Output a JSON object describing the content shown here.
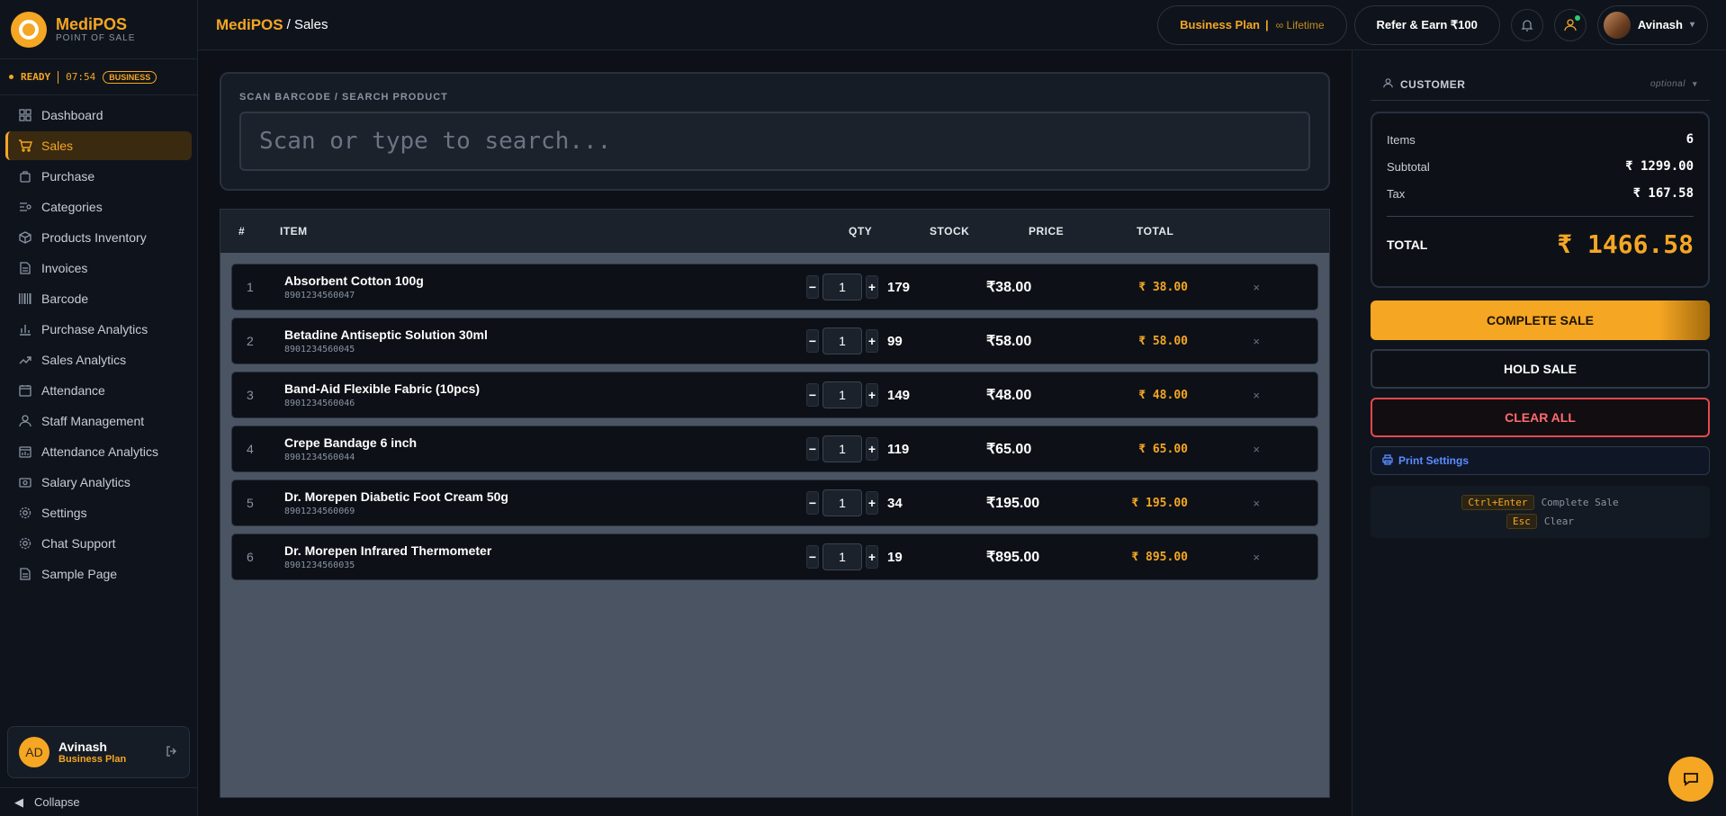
{
  "brand": {
    "name": "MediPOS",
    "subtitle": "POINT OF SALE"
  },
  "status": {
    "state": "READY",
    "time": "07:54",
    "badge": "BUSINESS"
  },
  "sidebar": {
    "items": [
      {
        "label": "Dashboard",
        "icon": "grid-icon",
        "active": false
      },
      {
        "label": "Sales",
        "icon": "cart-icon",
        "active": true
      },
      {
        "label": "Purchase",
        "icon": "bag-icon",
        "active": false
      },
      {
        "label": "Categories",
        "icon": "list-filter-icon",
        "active": false
      },
      {
        "label": "Products Inventory",
        "icon": "box-icon",
        "active": false
      },
      {
        "label": "Invoices",
        "icon": "document-icon",
        "active": false
      },
      {
        "label": "Barcode",
        "icon": "barcode-icon",
        "active": false
      },
      {
        "label": "Purchase Analytics",
        "icon": "bar-chart-icon",
        "active": false
      },
      {
        "label": "Sales Analytics",
        "icon": "trend-icon",
        "active": false
      },
      {
        "label": "Attendance",
        "icon": "calendar-icon",
        "active": false
      },
      {
        "label": "Staff Management",
        "icon": "user-icon",
        "active": false
      },
      {
        "label": "Attendance Analytics",
        "icon": "calendar-chart-icon",
        "active": false
      },
      {
        "label": "Salary Analytics",
        "icon": "money-icon",
        "active": false
      },
      {
        "label": "Settings",
        "icon": "gear-icon",
        "active": false
      },
      {
        "label": "Chat Support",
        "icon": "gear-icon",
        "active": false
      },
      {
        "label": "Sample Page",
        "icon": "document-icon",
        "active": false
      }
    ],
    "user": {
      "initials": "AD",
      "name": "Avinash",
      "plan": "Business Plan"
    },
    "collapse_label": "Collapse"
  },
  "header": {
    "brand": "MediPOS",
    "page": "/ Sales",
    "plan_label": "Business Plan",
    "plan_sep": "|",
    "plan_term": "∞ Lifetime",
    "refer_label": "Refer & Earn ₹100",
    "user_name": "Avinash"
  },
  "search": {
    "label": "SCAN BARCODE / SEARCH PRODUCT",
    "placeholder": "Scan or type to search...",
    "value": ""
  },
  "table": {
    "headers": {
      "num": "#",
      "item": "ITEM",
      "qty": "QTY",
      "stock": "STOCK",
      "price": "PRICE",
      "total": "TOTAL"
    },
    "rows": [
      {
        "num": "1",
        "name": "Absorbent Cotton 100g",
        "code": "8901234560047",
        "qty": "1",
        "stock": "179",
        "price": "₹38.00",
        "total": "₹ 38.00"
      },
      {
        "num": "2",
        "name": "Betadine Antiseptic Solution 30ml",
        "code": "8901234560045",
        "qty": "1",
        "stock": "99",
        "price": "₹58.00",
        "total": "₹ 58.00"
      },
      {
        "num": "3",
        "name": "Band-Aid Flexible Fabric (10pcs)",
        "code": "8901234560046",
        "qty": "1",
        "stock": "149",
        "price": "₹48.00",
        "total": "₹ 48.00"
      },
      {
        "num": "4",
        "name": "Crepe Bandage 6 inch",
        "code": "8901234560044",
        "qty": "1",
        "stock": "119",
        "price": "₹65.00",
        "total": "₹ 65.00"
      },
      {
        "num": "5",
        "name": "Dr. Morepen Diabetic Foot Cream 50g",
        "code": "8901234560069",
        "qty": "1",
        "stock": "34",
        "price": "₹195.00",
        "total": "₹ 195.00"
      },
      {
        "num": "6",
        "name": "Dr. Morepen Infrared Thermometer",
        "code": "8901234560035",
        "qty": "1",
        "stock": "19",
        "price": "₹895.00",
        "total": "₹ 895.00"
      }
    ],
    "minus": "−",
    "plus": "+",
    "remove": "×"
  },
  "customer": {
    "label": "CUSTOMER",
    "optional": "optional"
  },
  "summary": {
    "items_label": "Items",
    "items_value": "6",
    "subtotal_label": "Subtotal",
    "subtotal_value": "₹ 1299.00",
    "tax_label": "Tax",
    "tax_value": "₹ 167.58",
    "total_label": "TOTAL",
    "total_value": "₹ 1466.58"
  },
  "actions": {
    "complete": "COMPLETE SALE",
    "hold": "HOLD SALE",
    "clear": "CLEAR ALL",
    "print": "Print Settings"
  },
  "shortcuts": [
    {
      "key": "Ctrl+Enter",
      "action": "Complete Sale"
    },
    {
      "key": "Esc",
      "action": "Clear"
    }
  ],
  "colors": {
    "accent": "#f5a623",
    "danger": "#e5484d",
    "link": "#5b8cff"
  }
}
